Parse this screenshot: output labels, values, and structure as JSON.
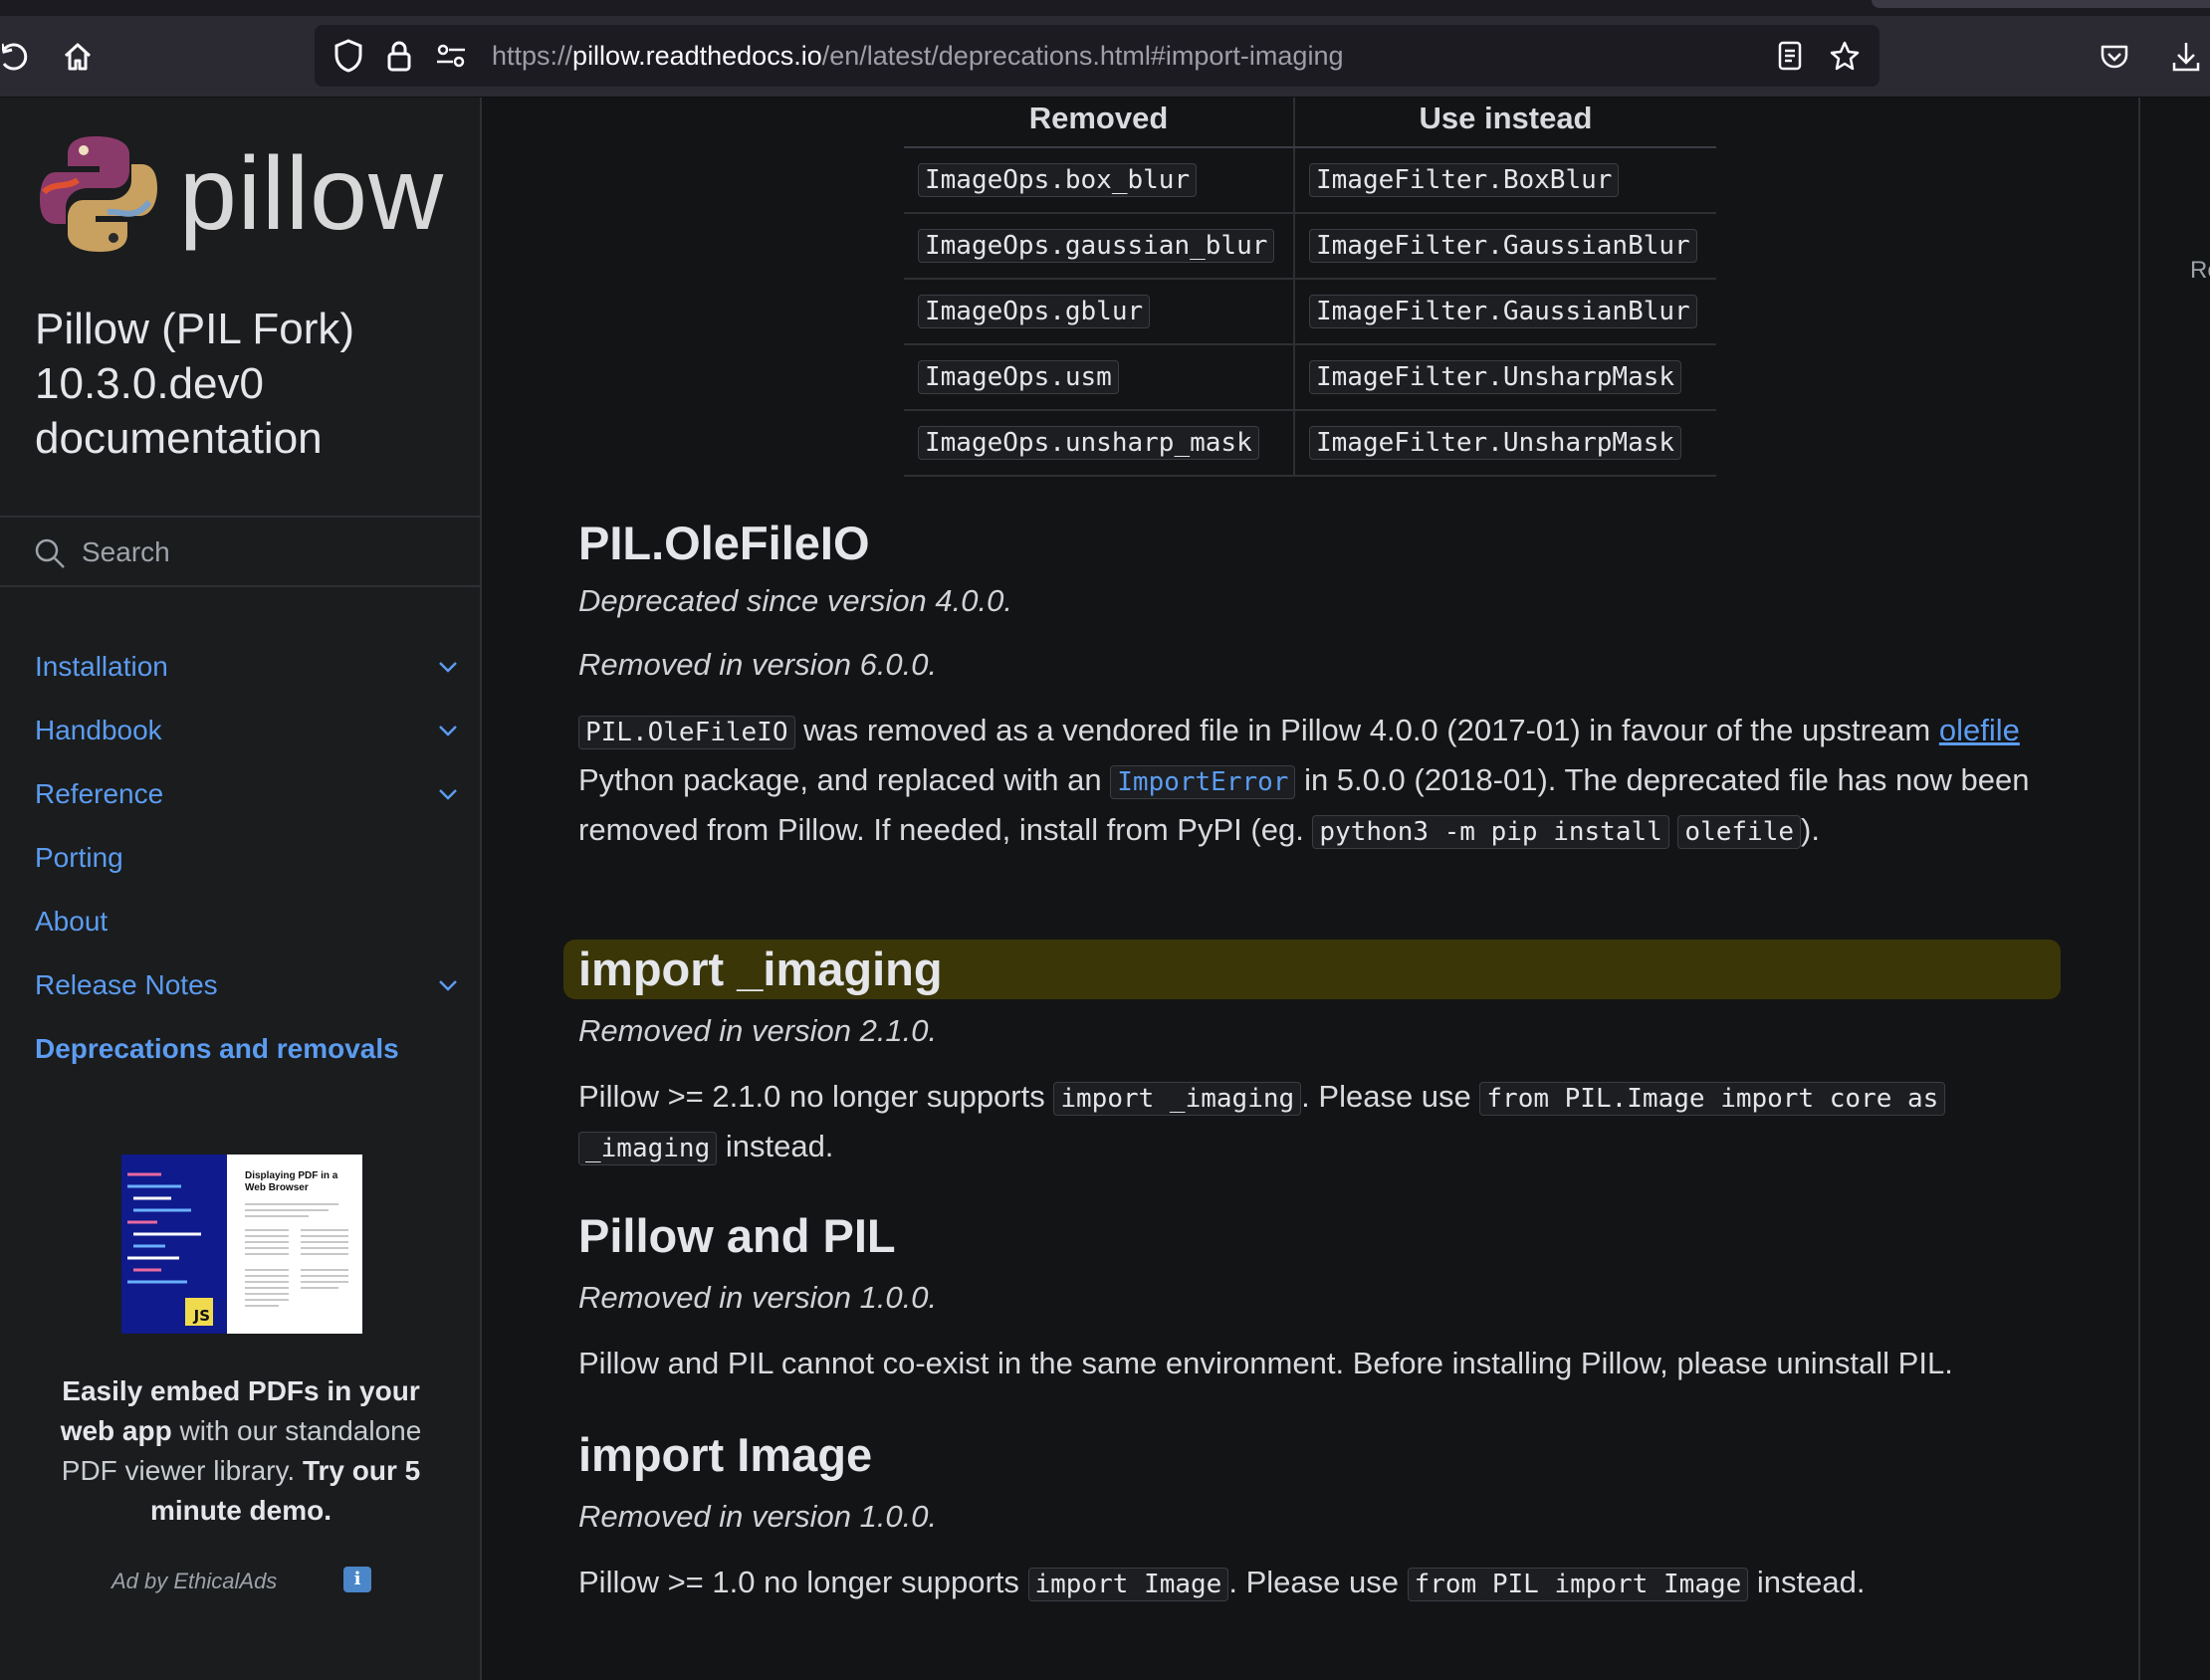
{
  "browser": {
    "url_scheme": "https://",
    "url_host": "pillow.readthedocs.io",
    "url_path": "/en/latest/deprecations.html#import-imaging"
  },
  "sidebar": {
    "logo_text": "pillow",
    "title": "Pillow (PIL Fork) 10.3.0.dev0 documentation",
    "search_placeholder": "Search",
    "nav": [
      {
        "label": "Installation",
        "expandable": true
      },
      {
        "label": "Handbook",
        "expandable": true
      },
      {
        "label": "Reference",
        "expandable": true
      },
      {
        "label": "Porting",
        "expandable": false
      },
      {
        "label": "About",
        "expandable": false
      },
      {
        "label": "Release Notes",
        "expandable": true
      },
      {
        "label": "Deprecations and removals",
        "expandable": false,
        "active": true
      }
    ],
    "ad": {
      "image_heading": "Displaying PDF in a Web Browser",
      "image_badge": "JS",
      "text_bold_1": "Easily embed PDFs in your web app",
      "text_plain_1": " with our standalone PDF viewer library. ",
      "text_bold_2": "Try our 5 minute demo.",
      "by": "Ad by EthicalAds",
      "info": "i"
    }
  },
  "right_pane": {
    "partial_text": "Re"
  },
  "table": {
    "headers": [
      "Removed",
      "Use instead"
    ],
    "rows": [
      [
        "ImageOps.box_blur",
        "ImageFilter.BoxBlur"
      ],
      [
        "ImageOps.gaussian_blur",
        "ImageFilter.GaussianBlur"
      ],
      [
        "ImageOps.gblur",
        "ImageFilter.GaussianBlur"
      ],
      [
        "ImageOps.usm",
        "ImageFilter.UnsharpMask"
      ],
      [
        "ImageOps.unsharp_mask",
        "ImageFilter.UnsharpMask"
      ]
    ]
  },
  "sections": {
    "olefileio": {
      "title": "PIL.OleFileIO",
      "deprecated": "Deprecated since version 4.0.0.",
      "removed": "Removed in version 6.0.0.",
      "code1": "PIL.OleFileIO",
      "text1": " was removed as a vendored file in Pillow 4.0.0 (2017-01) in favour of the upstream ",
      "link": "olefile",
      "text2": " Python package, and replaced with an ",
      "code2": "ImportError",
      "text3": " in 5.0.0 (2018-01). The deprecated file has now been removed from Pillow. If needed, install from PyPI (eg. ",
      "code3a": "python3 -m pip install",
      "code3b": "olefile",
      "text4": ")."
    },
    "imaging": {
      "title": "import _imaging",
      "removed": "Removed in version 2.1.0.",
      "text1": "Pillow >= 2.1.0 no longer supports ",
      "code1": "import _imaging",
      "text2": ". Please use ",
      "code2a": "from PIL.Image import core as",
      "code2b": "_imaging",
      "text3": " instead."
    },
    "pillow_pil": {
      "title": "Pillow and PIL",
      "removed": "Removed in version 1.0.0.",
      "text": "Pillow and PIL cannot co-exist in the same environment. Before installing Pillow, please uninstall PIL."
    },
    "import_image": {
      "title": "import Image",
      "removed": "Removed in version 1.0.0.",
      "text1": "Pillow >= 1.0 no longer supports ",
      "code1": "import Image",
      "text2": ". Please use ",
      "code2": "from PIL import Image",
      "text3": " instead."
    }
  }
}
